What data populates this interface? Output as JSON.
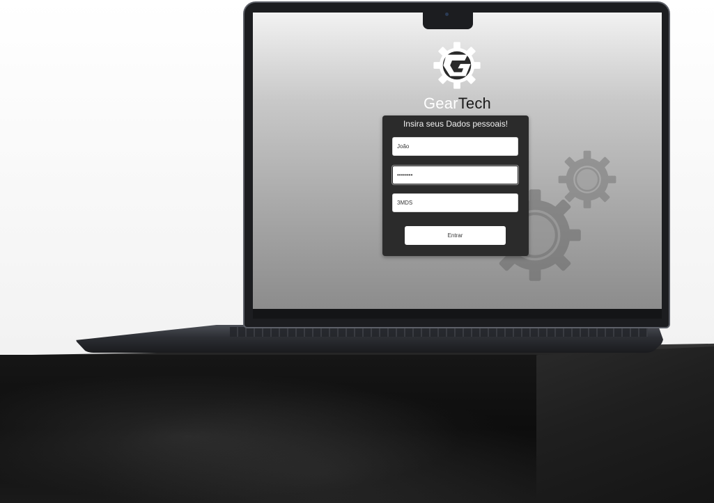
{
  "brand": {
    "name_part1": "Gear",
    "name_part2": "Tech",
    "logo_icon": "gear-g-logo-icon"
  },
  "login": {
    "title": "Insira seus Dados pessoais!",
    "name_value": "João",
    "password_value": "••••••••",
    "class_value": "3MDS",
    "submit_label": "Entrar"
  },
  "colors": {
    "form_bg": "#2b2b2b",
    "screen_top": "#f2f2f2",
    "screen_bottom": "#8c8c8c",
    "brand_light": "#ffffff",
    "brand_dark": "#1b1b1b"
  },
  "decor": {
    "background_icons": [
      "gear-icon",
      "gear-icon"
    ]
  }
}
